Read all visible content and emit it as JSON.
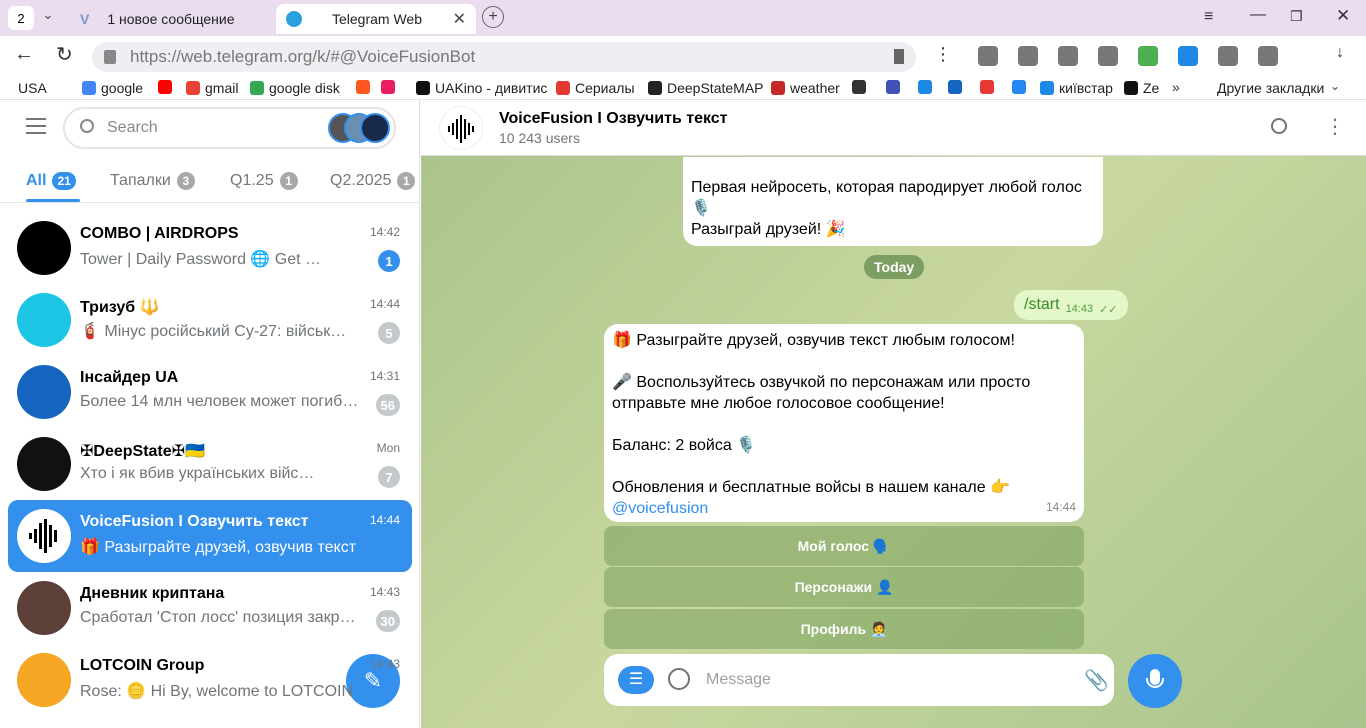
{
  "browser": {
    "tab_count": "2",
    "tab1_title": "1 новое сообщение",
    "tab2_title": "Telegram Web",
    "url_host": "https://web.telegram.org",
    "url_path": "/k/#@VoiceFusionBot",
    "other_bookmarks": "Другие закладки",
    "bookmarks": [
      {
        "label": "USA",
        "color": "#ffffff"
      },
      {
        "label": "google",
        "color": "#4285f4"
      },
      {
        "label": "",
        "color": "#ff0000"
      },
      {
        "label": "gmail",
        "color": "#ea4335"
      },
      {
        "label": "google disk",
        "color": "#34a853"
      },
      {
        "label": "",
        "color": "#ff5722"
      },
      {
        "label": "",
        "color": "#e91e63"
      },
      {
        "label": "UAKino - дивитис",
        "color": "#111111"
      },
      {
        "label": "Сериалы",
        "color": "#e53935"
      },
      {
        "label": "DeepStateMAP",
        "color": "#222222"
      },
      {
        "label": "weather",
        "color": "#c62828"
      },
      {
        "label": "",
        "color": "#333333"
      },
      {
        "label": "",
        "color": "#3f51b5"
      },
      {
        "label": "",
        "color": "#1e88e5"
      },
      {
        "label": "",
        "color": "#1565c0"
      },
      {
        "label": "",
        "color": "#e53935"
      },
      {
        "label": "",
        "color": "#2787f5"
      },
      {
        "label": "київстар",
        "color": "#1e88e5"
      },
      {
        "label": "Ze",
        "color": "#111111"
      }
    ]
  },
  "sidebar": {
    "search_placeholder": "Search",
    "folders": [
      {
        "label": "All",
        "count": "21"
      },
      {
        "label": "Тапалки",
        "count": "3"
      },
      {
        "label": "Q1.25",
        "count": "1"
      },
      {
        "label": "Q2.2025",
        "count": "1"
      }
    ],
    "chats": [
      {
        "title": "COMBO | AIRDROPS",
        "message": "Tower | Daily Password 🌐 Get …",
        "time": "14:42",
        "badge": "1",
        "badge_color": "blue",
        "avatar_color": "#000000",
        "active": false
      },
      {
        "title": "Тризуб 🔱",
        "message": "🧯 Мінус російський Су-27: військ…",
        "time": "14:44",
        "badge": "5",
        "badge_color": "grey",
        "avatar_color": "#1ec6e6",
        "active": false
      },
      {
        "title": "Інсайдер UA",
        "message": "Более 14 млн человек может погиб…",
        "time": "14:31",
        "badge": "56",
        "badge_color": "grey",
        "avatar_color": "#1565c0",
        "active": false
      },
      {
        "title": "✠DeepState✠🇺🇦",
        "message": "Хто і як вбив українських війс…",
        "time": "Mon",
        "badge": "7",
        "badge_color": "grey",
        "avatar_color": "#111111",
        "active": false
      },
      {
        "title": "VoiceFusion I Озвучить текст",
        "message": "🎁 Разыграйте друзей, озвучив текст лю…",
        "time": "14:44",
        "badge": "",
        "badge_color": "",
        "avatar_color": "#ffffff",
        "active": true
      },
      {
        "title": "Дневник криптана",
        "message": "Сработал 'Стоп лосс' позиция закр…",
        "time": "14:43",
        "badge": "30",
        "badge_color": "grey",
        "avatar_color": "#5d4037",
        "active": false
      },
      {
        "title": "LOTCOIN Group",
        "message": "Rose: 🪙 Hi By, welcome to LOTCOIN",
        "time": "14:43",
        "badge": "",
        "badge_color": "",
        "avatar_color": "#f5a623",
        "active": false
      }
    ]
  },
  "chat": {
    "title": "VoiceFusion I Озвучить текст",
    "subtitle": "10 243 users",
    "prev_message_lines": [
      "Первая нейросеть, которая пародирует любой голос",
      "🎙️",
      "Разыграй друзей! 🎉"
    ],
    "date_separator": "Today",
    "outgoing": {
      "text": "/start",
      "time": "14:43"
    },
    "incoming": {
      "lines": [
        "🎁 Разыграйте друзей, озвучив текст любым голосом!",
        "",
        "🎤 Воспользуйтесь озвучкой по персонажам или просто",
        "отправьте мне любое голосовое сообщение!",
        "",
        "Баланс: 2 войса 🎙️",
        "",
        "Обновления и бесплатные войсы в нашем канале 👉"
      ],
      "link": "@voicefusion",
      "time": "14:44"
    },
    "keyboard": [
      "Мой голос 🗣️",
      "Персонажи 👤",
      "Профиль 🧑‍💼"
    ],
    "input_placeholder": "Message"
  }
}
